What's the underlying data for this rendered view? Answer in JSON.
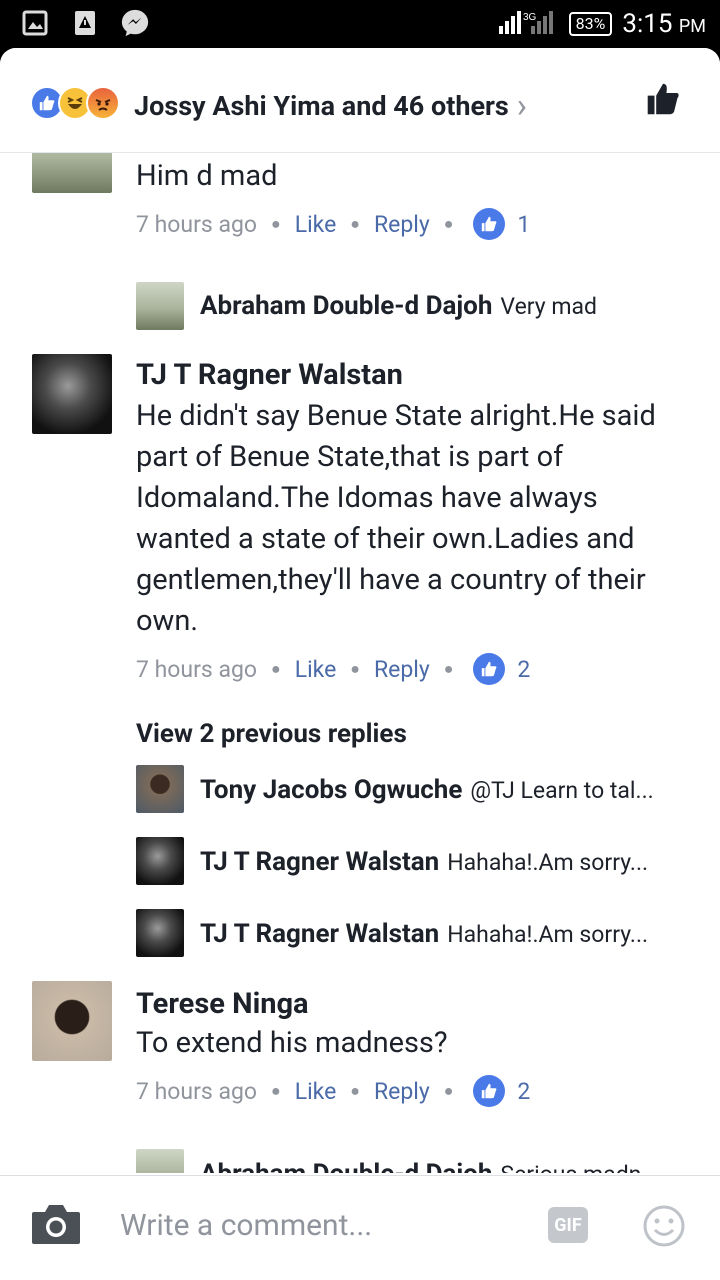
{
  "status_bar": {
    "network": "3G",
    "battery": "83%",
    "time": "3:15",
    "ampm": "PM"
  },
  "reactions": {
    "summary": "Jossy Ashi Yima and 46 others",
    "icons": [
      "like-icon",
      "haha-icon",
      "angry-icon"
    ]
  },
  "comments": [
    {
      "text": "Him d mad",
      "time": "7 hours ago",
      "like": "Like",
      "reply": "Reply",
      "likes": "1",
      "replies": [
        {
          "name": "Abraham Double-d Dajoh",
          "text": "Very mad"
        }
      ]
    },
    {
      "name": "TJ T Ragner Walstan",
      "text": "He didn't say Benue State alright.He said part of Benue State,that is part of Idomaland.The Idomas have always wanted a state of their own.Ladies and gentlemen,they'll have a country of their own.",
      "time": "7 hours ago",
      "like": "Like",
      "reply": "Reply",
      "likes": "2",
      "view_previous": "View 2 previous replies",
      "replies": [
        {
          "name": "Tony Jacobs Ogwuche",
          "text": "@TJ Learn to tal..."
        },
        {
          "name": "TJ T Ragner Walstan",
          "text": "Hahaha!.Am sorry..."
        },
        {
          "name": "TJ T Ragner Walstan",
          "text": "Hahaha!.Am sorry..."
        }
      ]
    },
    {
      "name": "Terese Ninga",
      "text": "To extend his madness?",
      "time": "7 hours ago",
      "like": "Like",
      "reply": "Reply",
      "likes": "2",
      "replies": [
        {
          "name": "Abraham Double-d Dajoh",
          "text": "Serious madn..."
        }
      ]
    }
  ],
  "composer": {
    "placeholder": "Write a comment...",
    "gif_label": "GIF"
  },
  "colors": {
    "accent": "#4b6ba8",
    "like_blue": "#4a79e8",
    "text": "#1d2129",
    "muted": "#90949c"
  }
}
